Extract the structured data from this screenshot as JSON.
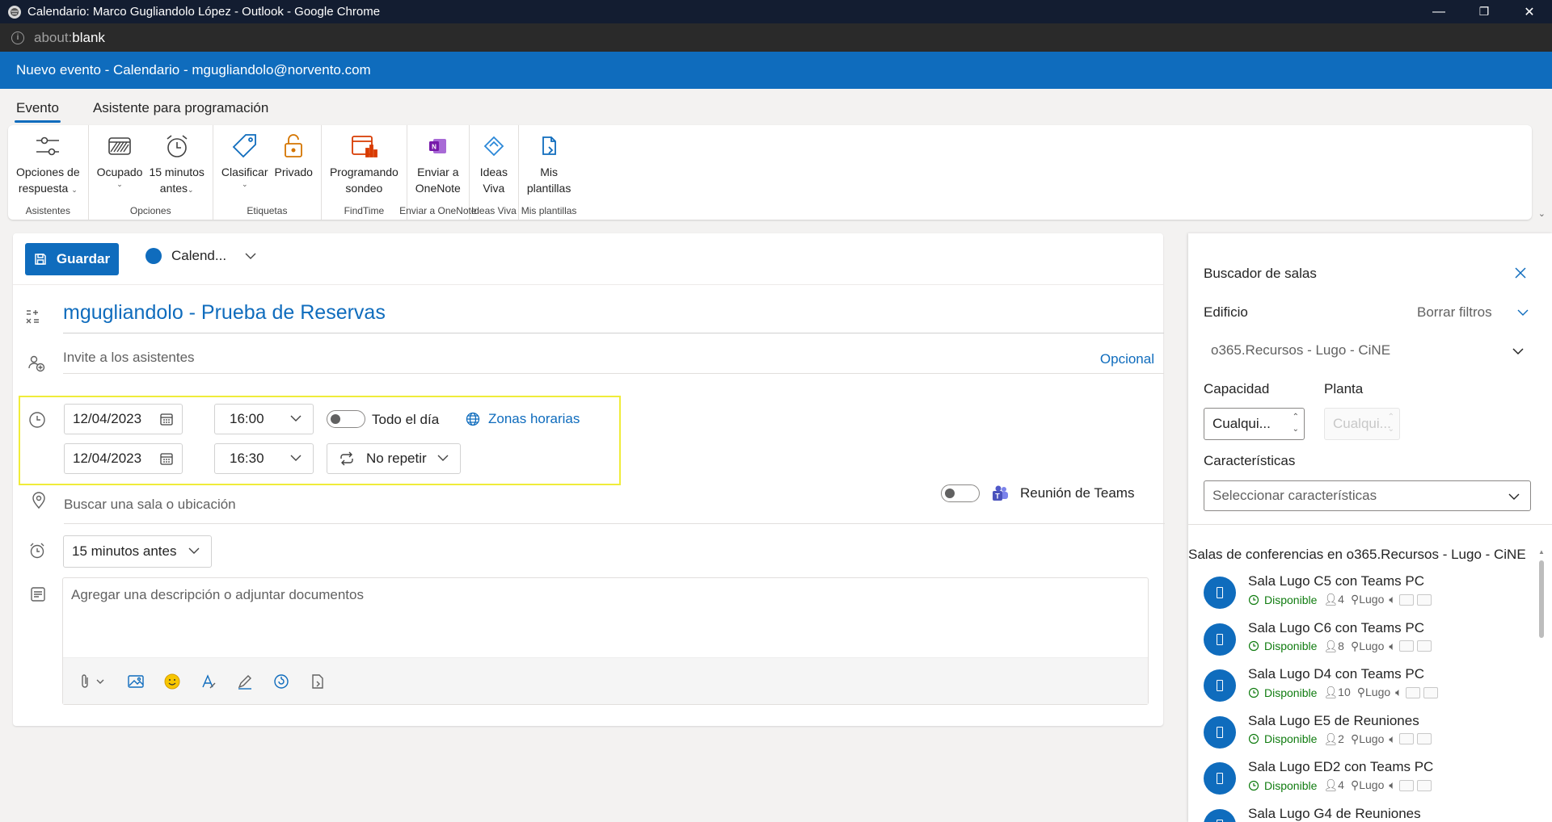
{
  "browser": {
    "title": "Calendario: Marco Gugliandolo López - Outlook - Google Chrome",
    "url_scheme": "about:",
    "url_rest": "blank",
    "minimize": "—",
    "maximize": "❐",
    "close": "✕"
  },
  "header": {
    "title": "Nuevo evento - Calendario - mgugliandolo@norvento.com"
  },
  "tabs": [
    {
      "label": "Evento",
      "active": true
    },
    {
      "label": "Asistente para programación",
      "active": false
    }
  ],
  "ribbon": {
    "groups": [
      {
        "label": "Asistentes",
        "buttons": [
          {
            "line1": "Opciones de",
            "line2": "respuesta",
            "caret": "⌄",
            "icon": "response-options-icon"
          }
        ]
      },
      {
        "label": "Opciones",
        "buttons": [
          {
            "line1": "Ocupado",
            "line2": "",
            "caret": "⌄",
            "icon": "busy-icon"
          },
          {
            "line1": "15 minutos",
            "line2": "antes",
            "caret": "⌄",
            "icon": "alarm-clock-icon"
          }
        ]
      },
      {
        "label": "Etiquetas",
        "buttons": [
          {
            "line1": "Clasificar",
            "line2": "",
            "caret": "⌄",
            "icon": "tag-icon"
          },
          {
            "line1": "Privado",
            "line2": "",
            "caret": "",
            "icon": "lock-icon"
          }
        ]
      },
      {
        "label": "FindTime",
        "buttons": [
          {
            "line1": "Programando",
            "line2": "sondeo",
            "caret": "",
            "icon": "poll-icon"
          }
        ]
      },
      {
        "label": "Enviar a OneNote",
        "buttons": [
          {
            "line1": "Enviar a",
            "line2": "OneNote",
            "caret": "",
            "icon": "onenote-icon"
          }
        ]
      },
      {
        "label": "Ideas Viva",
        "buttons": [
          {
            "line1": "Ideas",
            "line2": "Viva",
            "caret": "",
            "icon": "viva-icon"
          }
        ]
      },
      {
        "label": "Mis plantillas",
        "buttons": [
          {
            "line1": "Mis",
            "line2": "plantillas",
            "caret": "",
            "icon": "templates-icon"
          }
        ]
      }
    ]
  },
  "form": {
    "save_label": "Guardar",
    "calendar_label": "Calend...",
    "title": "mgugliandolo - Prueba de Reservas",
    "attendees_placeholder": "Invite a los asistentes",
    "optional_label": "Opcional",
    "start_date": "12/04/2023",
    "start_time": "16:00",
    "end_date": "12/04/2023",
    "end_time": "16:30",
    "allday_label": "Todo el día",
    "timezones_label": "Zonas horarias",
    "repeat_label": "No repetir",
    "location_placeholder": "Buscar una sala o ubicación",
    "teams_label": "Reunión de Teams",
    "reminder_label": "15 minutos antes",
    "description_placeholder": "Agregar una descripción o adjuntar documentos"
  },
  "room_finder": {
    "title": "Buscador de salas",
    "building_label": "Edificio",
    "clear_filters": "Borrar filtros",
    "building_value": "o365.Recursos - Lugo - CiNE",
    "capacity_label": "Capacidad",
    "floor_label": "Planta",
    "capacity_value": "Cualqui...",
    "floor_value": "Cualqui...",
    "features_label": "Características",
    "features_placeholder": "Seleccionar características",
    "rooms_header": "Salas de conferencias en o365.Recursos - Lugo - CiNE",
    "rooms": [
      {
        "name": "Sala Lugo C5 con Teams PC",
        "status": "Disponible",
        "capacity": "4",
        "location": "Lugo"
      },
      {
        "name": "Sala Lugo C6 con Teams PC",
        "status": "Disponible",
        "capacity": "8",
        "location": "Lugo"
      },
      {
        "name": "Sala Lugo D4 con Teams PC",
        "status": "Disponible",
        "capacity": "10",
        "location": "Lugo"
      },
      {
        "name": "Sala Lugo E5 de Reuniones",
        "status": "Disponible",
        "capacity": "2",
        "location": "Lugo"
      },
      {
        "name": "Sala Lugo ED2 con Teams PC",
        "status": "Disponible",
        "capacity": "4",
        "location": "Lugo"
      },
      {
        "name": "Sala Lugo G4 de Reuniones",
        "status": "",
        "capacity": "",
        "location": ""
      }
    ]
  },
  "colors": {
    "accent": "#0f6cbd",
    "titlebar": "#131d31",
    "available": "#107c10",
    "highlight": "#f0ec3a"
  }
}
